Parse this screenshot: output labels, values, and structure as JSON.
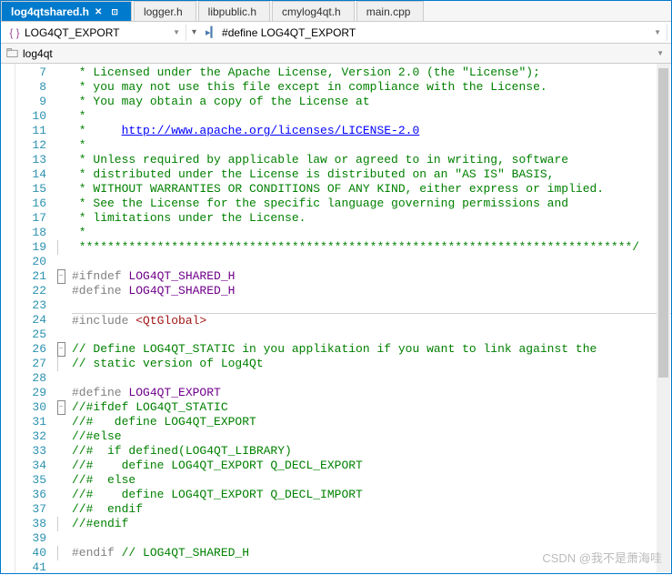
{
  "tabs": {
    "items": [
      {
        "label": "log4qtshared.h",
        "active": true
      },
      {
        "label": "logger.h",
        "active": false
      },
      {
        "label": "libpublic.h",
        "active": false
      },
      {
        "label": "cmylog4qt.h",
        "active": false
      },
      {
        "label": "main.cpp",
        "active": false
      }
    ]
  },
  "nav": {
    "scope": "LOG4QT_EXPORT",
    "member": "#define LOG4QT_EXPORT"
  },
  "context": {
    "path": "log4qt"
  },
  "lines": [
    {
      "n": 7,
      "fold": "",
      "tokens": [
        {
          "cls": "c-comment",
          "t": " * Licensed under the Apache License, Version 2.0 (the \"License\");"
        }
      ]
    },
    {
      "n": 8,
      "fold": "",
      "tokens": [
        {
          "cls": "c-comment",
          "t": " * you may not use this file except in compliance with the License."
        }
      ]
    },
    {
      "n": 9,
      "fold": "",
      "tokens": [
        {
          "cls": "c-comment",
          "t": " * You may obtain a copy of the License at"
        }
      ]
    },
    {
      "n": 10,
      "fold": "",
      "tokens": [
        {
          "cls": "c-comment",
          "t": " *"
        }
      ]
    },
    {
      "n": 11,
      "fold": "",
      "tokens": [
        {
          "cls": "c-comment",
          "t": " *     "
        },
        {
          "cls": "c-link",
          "t": "http://www.apache.org/licenses/LICENSE-2.0"
        }
      ]
    },
    {
      "n": 12,
      "fold": "",
      "tokens": [
        {
          "cls": "c-comment",
          "t": " *"
        }
      ]
    },
    {
      "n": 13,
      "fold": "",
      "tokens": [
        {
          "cls": "c-comment",
          "t": " * Unless required by applicable law or agreed to in writing, software"
        }
      ]
    },
    {
      "n": 14,
      "fold": "",
      "tokens": [
        {
          "cls": "c-comment",
          "t": " * distributed under the License is distributed on an \"AS IS\" BASIS,"
        }
      ]
    },
    {
      "n": 15,
      "fold": "",
      "tokens": [
        {
          "cls": "c-comment",
          "t": " * WITHOUT WARRANTIES OR CONDITIONS OF ANY KIND, either express or implied."
        }
      ]
    },
    {
      "n": 16,
      "fold": "",
      "tokens": [
        {
          "cls": "c-comment",
          "t": " * See the License for the specific language governing permissions and"
        }
      ]
    },
    {
      "n": 17,
      "fold": "",
      "tokens": [
        {
          "cls": "c-comment",
          "t": " * limitations under the License."
        }
      ]
    },
    {
      "n": 18,
      "fold": "",
      "tokens": [
        {
          "cls": "c-comment",
          "t": " *"
        }
      ]
    },
    {
      "n": 19,
      "fold": "end",
      "tokens": [
        {
          "cls": "c-comment",
          "t": " ******************************************************************************/"
        }
      ]
    },
    {
      "n": 20,
      "fold": "",
      "tokens": []
    },
    {
      "n": 21,
      "fold": "open",
      "tokens": [
        {
          "cls": "c-preproc",
          "t": "#ifndef "
        },
        {
          "cls": "c-macro",
          "t": "LOG4QT_SHARED_H"
        }
      ]
    },
    {
      "n": 22,
      "fold": "",
      "tokens": [
        {
          "cls": "c-preproc",
          "t": "#define "
        },
        {
          "cls": "c-macro",
          "t": "LOG4QT_SHARED_H"
        }
      ]
    },
    {
      "n": 23,
      "fold": "",
      "tokens": []
    },
    {
      "n": 24,
      "fold": "",
      "hl": true,
      "tokens": [
        {
          "cls": "c-preproc",
          "t": "#include "
        },
        {
          "cls": "c-string",
          "t": "<QtGlobal>"
        }
      ]
    },
    {
      "n": 25,
      "fold": "",
      "tokens": []
    },
    {
      "n": 26,
      "fold": "open",
      "tokens": [
        {
          "cls": "c-comment",
          "t": "// Define LOG4QT_STATIC in you applikation if you want to link against the"
        }
      ]
    },
    {
      "n": 27,
      "fold": "end",
      "tokens": [
        {
          "cls": "c-comment",
          "t": "// static version of Log4Qt"
        }
      ]
    },
    {
      "n": 28,
      "fold": "",
      "tokens": []
    },
    {
      "n": 29,
      "fold": "",
      "tokens": [
        {
          "cls": "c-preproc",
          "t": "#define "
        },
        {
          "cls": "c-macro",
          "t": "LOG4QT_EXPORT"
        }
      ]
    },
    {
      "n": 30,
      "fold": "open",
      "tokens": [
        {
          "cls": "c-comment",
          "t": "//#ifdef LOG4QT_STATIC"
        }
      ]
    },
    {
      "n": 31,
      "fold": "",
      "tokens": [
        {
          "cls": "c-comment",
          "t": "//#   define LOG4QT_EXPORT"
        }
      ]
    },
    {
      "n": 32,
      "fold": "",
      "tokens": [
        {
          "cls": "c-comment",
          "t": "//#else"
        }
      ]
    },
    {
      "n": 33,
      "fold": "",
      "tokens": [
        {
          "cls": "c-comment",
          "t": "//#  if defined(LOG4QT_LIBRARY)"
        }
      ]
    },
    {
      "n": 34,
      "fold": "",
      "tokens": [
        {
          "cls": "c-comment",
          "t": "//#    define LOG4QT_EXPORT Q_DECL_EXPORT"
        }
      ]
    },
    {
      "n": 35,
      "fold": "",
      "tokens": [
        {
          "cls": "c-comment",
          "t": "//#  else"
        }
      ]
    },
    {
      "n": 36,
      "fold": "",
      "tokens": [
        {
          "cls": "c-comment",
          "t": "//#    define LOG4QT_EXPORT Q_DECL_IMPORT"
        }
      ]
    },
    {
      "n": 37,
      "fold": "",
      "tokens": [
        {
          "cls": "c-comment",
          "t": "//#  endif"
        }
      ]
    },
    {
      "n": 38,
      "fold": "end",
      "tokens": [
        {
          "cls": "c-comment",
          "t": "//#endif"
        }
      ]
    },
    {
      "n": 39,
      "fold": "",
      "tokens": []
    },
    {
      "n": 40,
      "fold": "end",
      "tokens": [
        {
          "cls": "c-preproc",
          "t": "#endif "
        },
        {
          "cls": "c-comment",
          "t": "// LOG4QT_SHARED_H"
        }
      ]
    },
    {
      "n": 41,
      "fold": "",
      "tokens": []
    }
  ],
  "watermark": "CSDN @我不是萧海哇"
}
